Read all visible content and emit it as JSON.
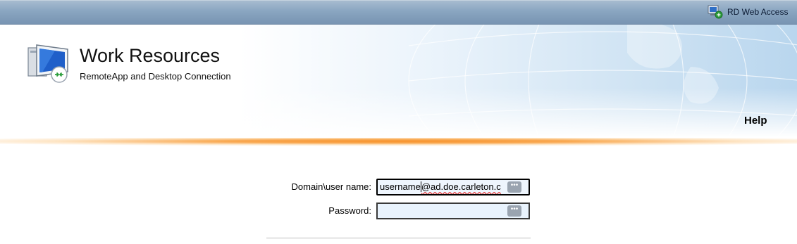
{
  "header": {
    "rd_web_access_label": "RD Web Access",
    "title": "Work Resources",
    "subtitle": "RemoteApp and Desktop Connection",
    "help_label": "Help"
  },
  "login": {
    "username_label": "Domain\\user name:",
    "username_value_before_caret": "username",
    "username_value_after_caret": "@ad.doe.carleton.c",
    "password_label": "Password:",
    "password_value": ""
  },
  "colors": {
    "topbar": "#8aa6c1",
    "accent_orange": "#f7922c",
    "field_background": "#e9f3fd"
  },
  "icons": {
    "rd_web_access": "rd-web-access-icon",
    "app": "remote-desktop-monitor-icon",
    "field_button": "password-manager-dots-icon"
  }
}
